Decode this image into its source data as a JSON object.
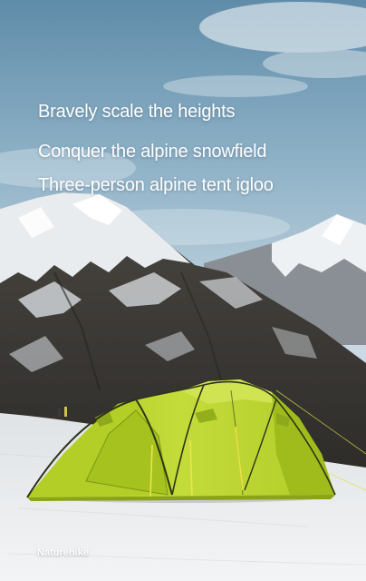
{
  "headlines": {
    "line1": "Bravely scale the heights",
    "line2": "Conquer the alpine snowfield",
    "line3": "Three-person alpine tent igloo"
  },
  "brand": {
    "name": "Naturehike"
  },
  "colors": {
    "sky_top": "#6c98b3",
    "sky_bottom": "#cfdde6",
    "rock_dark": "#3a3834",
    "snow": "#eef0f2",
    "tent_lime": "#b8d42a",
    "tent_lime_shade": "#8fab1a",
    "tent_pole": "#e8e04a",
    "text": "#ffffff"
  }
}
